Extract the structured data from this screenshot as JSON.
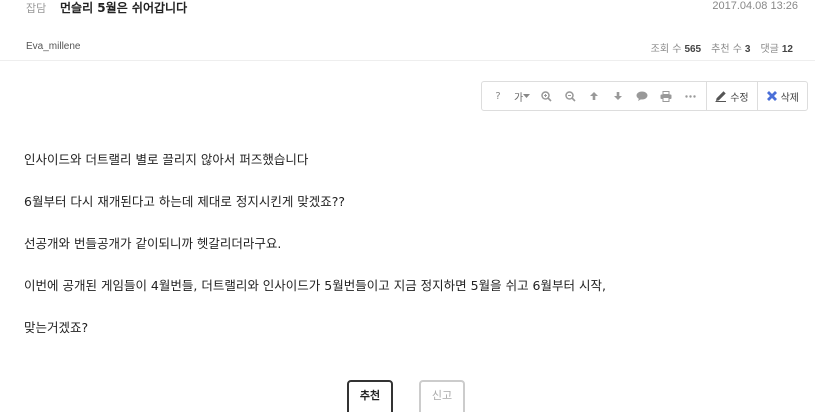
{
  "post": {
    "category": "잡담",
    "title": "먼슬리 5월은 쉬어갑니다",
    "date": "2017.04.08 13:26",
    "author": "Eva_millene",
    "stats": {
      "views_label": "조회 수",
      "views": "565",
      "recommend_label": "추천 수",
      "recommend": "3",
      "comments_label": "댓글",
      "comments": "12"
    }
  },
  "toolbar": {
    "help": "?",
    "font": "가",
    "edit_label": "수정",
    "delete_label": "삭제",
    "icons": [
      "help-icon",
      "font-size-icon",
      "zoom-in-icon",
      "zoom-out-icon",
      "arrow-up-icon",
      "arrow-down-icon",
      "comment-icon",
      "print-icon",
      "more-icon",
      "pencil-icon",
      "close-icon"
    ],
    "delete_color": "#4a6fd8"
  },
  "content": {
    "paragraphs": [
      "인사이드와 더트랠리 별로 끌리지 않아서 퍼즈했습니다",
      "6월부터 다시 재개된다고 하는데 제대로 정지시킨게 맞겠죠??",
      "선공개와 번들공개가 같이되니까 헷갈리더라구요.",
      "이번에 공개된 게임들이 4월번들, 더트랠리와 인사이드가 5월번들이고 지금 정지하면 5월을 쉬고 6월부터 시작,",
      "맞는거겠죠?"
    ]
  },
  "vote": {
    "recommend_label": "추천",
    "recommend_count": "",
    "report_label": "신고",
    "report_count": ""
  }
}
